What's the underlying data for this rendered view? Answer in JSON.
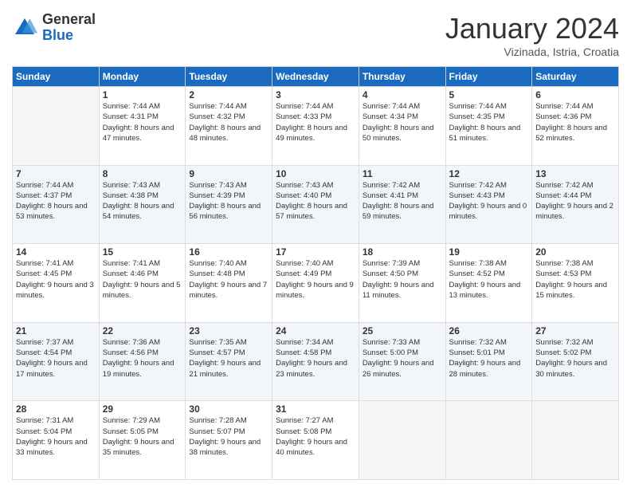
{
  "header": {
    "logo": {
      "general": "General",
      "blue": "Blue"
    },
    "title": "January 2024",
    "location": "Vizinada, Istria, Croatia"
  },
  "columns": [
    "Sunday",
    "Monday",
    "Tuesday",
    "Wednesday",
    "Thursday",
    "Friday",
    "Saturday"
  ],
  "weeks": [
    [
      {
        "day": "",
        "sunrise": "",
        "sunset": "",
        "daylight": ""
      },
      {
        "day": "1",
        "sunrise": "Sunrise: 7:44 AM",
        "sunset": "Sunset: 4:31 PM",
        "daylight": "Daylight: 8 hours and 47 minutes."
      },
      {
        "day": "2",
        "sunrise": "Sunrise: 7:44 AM",
        "sunset": "Sunset: 4:32 PM",
        "daylight": "Daylight: 8 hours and 48 minutes."
      },
      {
        "day": "3",
        "sunrise": "Sunrise: 7:44 AM",
        "sunset": "Sunset: 4:33 PM",
        "daylight": "Daylight: 8 hours and 49 minutes."
      },
      {
        "day": "4",
        "sunrise": "Sunrise: 7:44 AM",
        "sunset": "Sunset: 4:34 PM",
        "daylight": "Daylight: 8 hours and 50 minutes."
      },
      {
        "day": "5",
        "sunrise": "Sunrise: 7:44 AM",
        "sunset": "Sunset: 4:35 PM",
        "daylight": "Daylight: 8 hours and 51 minutes."
      },
      {
        "day": "6",
        "sunrise": "Sunrise: 7:44 AM",
        "sunset": "Sunset: 4:36 PM",
        "daylight": "Daylight: 8 hours and 52 minutes."
      }
    ],
    [
      {
        "day": "7",
        "sunrise": "Sunrise: 7:44 AM",
        "sunset": "Sunset: 4:37 PM",
        "daylight": "Daylight: 8 hours and 53 minutes."
      },
      {
        "day": "8",
        "sunrise": "Sunrise: 7:43 AM",
        "sunset": "Sunset: 4:38 PM",
        "daylight": "Daylight: 8 hours and 54 minutes."
      },
      {
        "day": "9",
        "sunrise": "Sunrise: 7:43 AM",
        "sunset": "Sunset: 4:39 PM",
        "daylight": "Daylight: 8 hours and 56 minutes."
      },
      {
        "day": "10",
        "sunrise": "Sunrise: 7:43 AM",
        "sunset": "Sunset: 4:40 PM",
        "daylight": "Daylight: 8 hours and 57 minutes."
      },
      {
        "day": "11",
        "sunrise": "Sunrise: 7:42 AM",
        "sunset": "Sunset: 4:41 PM",
        "daylight": "Daylight: 8 hours and 59 minutes."
      },
      {
        "day": "12",
        "sunrise": "Sunrise: 7:42 AM",
        "sunset": "Sunset: 4:43 PM",
        "daylight": "Daylight: 9 hours and 0 minutes."
      },
      {
        "day": "13",
        "sunrise": "Sunrise: 7:42 AM",
        "sunset": "Sunset: 4:44 PM",
        "daylight": "Daylight: 9 hours and 2 minutes."
      }
    ],
    [
      {
        "day": "14",
        "sunrise": "Sunrise: 7:41 AM",
        "sunset": "Sunset: 4:45 PM",
        "daylight": "Daylight: 9 hours and 3 minutes."
      },
      {
        "day": "15",
        "sunrise": "Sunrise: 7:41 AM",
        "sunset": "Sunset: 4:46 PM",
        "daylight": "Daylight: 9 hours and 5 minutes."
      },
      {
        "day": "16",
        "sunrise": "Sunrise: 7:40 AM",
        "sunset": "Sunset: 4:48 PM",
        "daylight": "Daylight: 9 hours and 7 minutes."
      },
      {
        "day": "17",
        "sunrise": "Sunrise: 7:40 AM",
        "sunset": "Sunset: 4:49 PM",
        "daylight": "Daylight: 9 hours and 9 minutes."
      },
      {
        "day": "18",
        "sunrise": "Sunrise: 7:39 AM",
        "sunset": "Sunset: 4:50 PM",
        "daylight": "Daylight: 9 hours and 11 minutes."
      },
      {
        "day": "19",
        "sunrise": "Sunrise: 7:38 AM",
        "sunset": "Sunset: 4:52 PM",
        "daylight": "Daylight: 9 hours and 13 minutes."
      },
      {
        "day": "20",
        "sunrise": "Sunrise: 7:38 AM",
        "sunset": "Sunset: 4:53 PM",
        "daylight": "Daylight: 9 hours and 15 minutes."
      }
    ],
    [
      {
        "day": "21",
        "sunrise": "Sunrise: 7:37 AM",
        "sunset": "Sunset: 4:54 PM",
        "daylight": "Daylight: 9 hours and 17 minutes."
      },
      {
        "day": "22",
        "sunrise": "Sunrise: 7:36 AM",
        "sunset": "Sunset: 4:56 PM",
        "daylight": "Daylight: 9 hours and 19 minutes."
      },
      {
        "day": "23",
        "sunrise": "Sunrise: 7:35 AM",
        "sunset": "Sunset: 4:57 PM",
        "daylight": "Daylight: 9 hours and 21 minutes."
      },
      {
        "day": "24",
        "sunrise": "Sunrise: 7:34 AM",
        "sunset": "Sunset: 4:58 PM",
        "daylight": "Daylight: 9 hours and 23 minutes."
      },
      {
        "day": "25",
        "sunrise": "Sunrise: 7:33 AM",
        "sunset": "Sunset: 5:00 PM",
        "daylight": "Daylight: 9 hours and 26 minutes."
      },
      {
        "day": "26",
        "sunrise": "Sunrise: 7:32 AM",
        "sunset": "Sunset: 5:01 PM",
        "daylight": "Daylight: 9 hours and 28 minutes."
      },
      {
        "day": "27",
        "sunrise": "Sunrise: 7:32 AM",
        "sunset": "Sunset: 5:02 PM",
        "daylight": "Daylight: 9 hours and 30 minutes."
      }
    ],
    [
      {
        "day": "28",
        "sunrise": "Sunrise: 7:31 AM",
        "sunset": "Sunset: 5:04 PM",
        "daylight": "Daylight: 9 hours and 33 minutes."
      },
      {
        "day": "29",
        "sunrise": "Sunrise: 7:29 AM",
        "sunset": "Sunset: 5:05 PM",
        "daylight": "Daylight: 9 hours and 35 minutes."
      },
      {
        "day": "30",
        "sunrise": "Sunrise: 7:28 AM",
        "sunset": "Sunset: 5:07 PM",
        "daylight": "Daylight: 9 hours and 38 minutes."
      },
      {
        "day": "31",
        "sunrise": "Sunrise: 7:27 AM",
        "sunset": "Sunset: 5:08 PM",
        "daylight": "Daylight: 9 hours and 40 minutes."
      },
      {
        "day": "",
        "sunrise": "",
        "sunset": "",
        "daylight": ""
      },
      {
        "day": "",
        "sunrise": "",
        "sunset": "",
        "daylight": ""
      },
      {
        "day": "",
        "sunrise": "",
        "sunset": "",
        "daylight": ""
      }
    ]
  ]
}
